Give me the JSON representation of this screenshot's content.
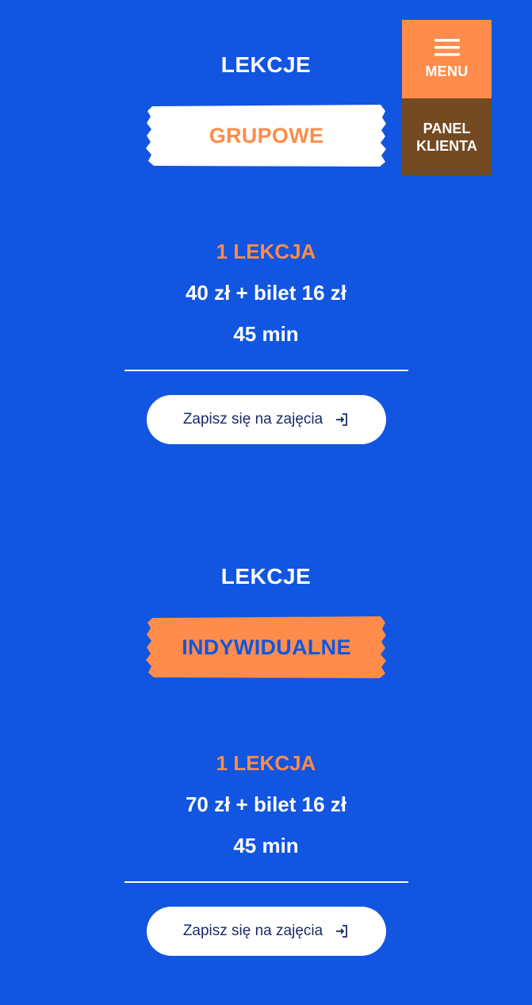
{
  "header": {
    "menu_label": "MENU",
    "panel_line1": "PANEL",
    "panel_line2": "KLIENTA"
  },
  "sections": [
    {
      "heading": "LEKCJE",
      "tag": "GRUPOWE",
      "tag_style": "white",
      "price_title": "1 LEKCJA",
      "price": "40 zł + bilet 16 zł",
      "duration": "45 min",
      "cta_label": "Zapisz się na zajęcia"
    },
    {
      "heading": "LEKCJE",
      "tag": "INDYWIDUALNE",
      "tag_style": "orange",
      "price_title": "1 LEKCJA",
      "price": "70 zł + bilet 16 zł",
      "duration": "45 min",
      "cta_label": "Zapisz się na zajęcia"
    }
  ],
  "colors": {
    "background": "#1155e0",
    "accent_orange": "#ff8c4a",
    "panel_brown": "#744a22",
    "white": "#ffffff",
    "cta_text": "#1a2a6a"
  },
  "icons": {
    "menu": "hamburger-icon",
    "cta": "sign-in-icon"
  }
}
